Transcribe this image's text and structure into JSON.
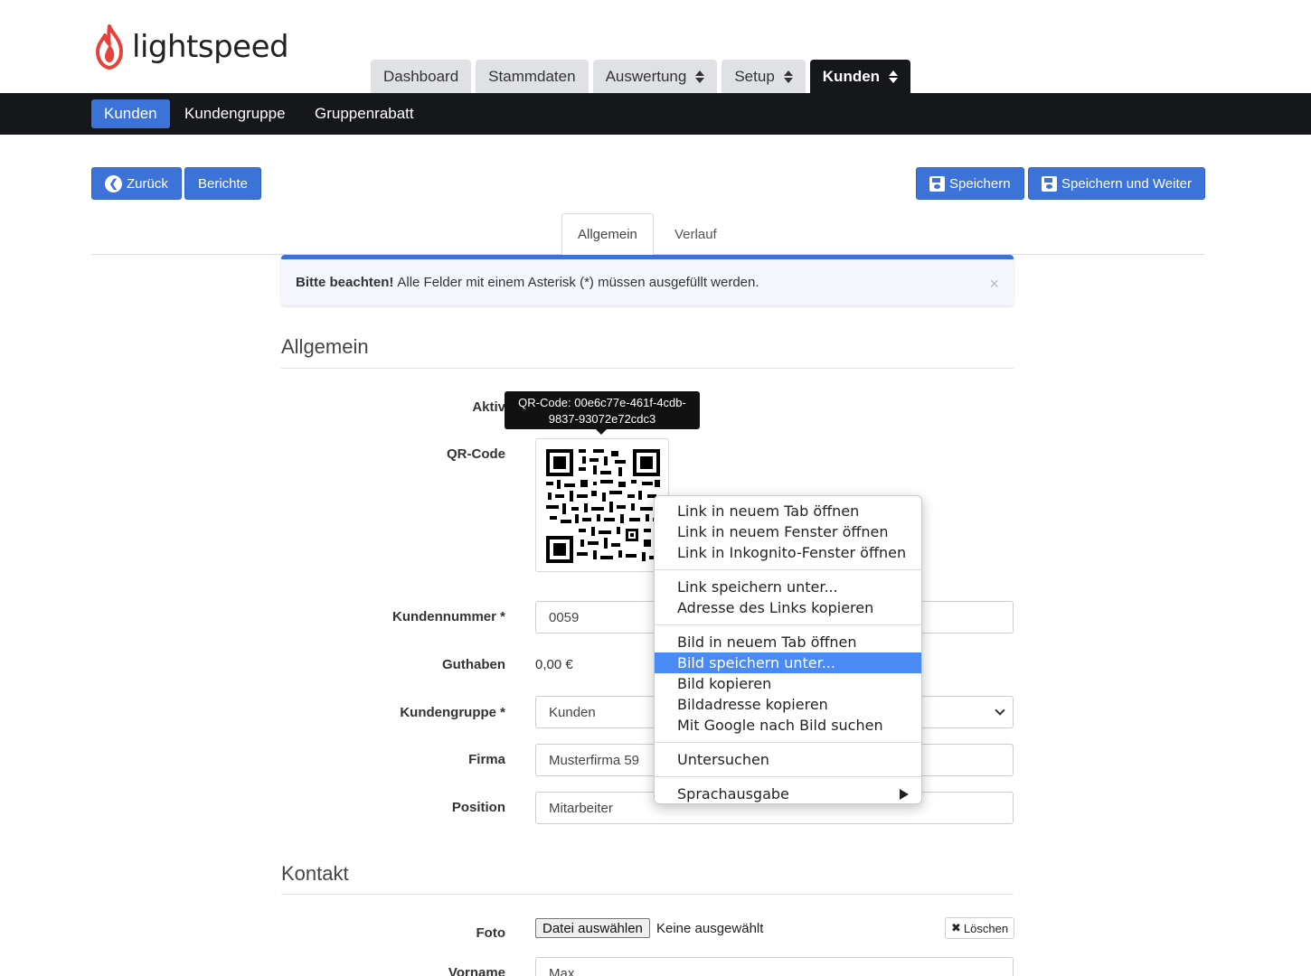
{
  "brand": {
    "name": "lightspeed",
    "logo_color": "#e8413c"
  },
  "main_tabs": [
    {
      "label": "Dashboard",
      "has_arrows": false,
      "active": false
    },
    {
      "label": "Stammdaten",
      "has_arrows": false,
      "active": false
    },
    {
      "label": "Auswertung",
      "has_arrows": true,
      "active": false
    },
    {
      "label": "Setup",
      "has_arrows": true,
      "active": false
    },
    {
      "label": "Kunden",
      "has_arrows": true,
      "active": true
    }
  ],
  "subnav": [
    {
      "label": "Kunden",
      "active": true
    },
    {
      "label": "Kundengruppe",
      "active": false
    },
    {
      "label": "Gruppenrabatt",
      "active": false
    }
  ],
  "actions": {
    "back_label": "Zurück",
    "reports_label": "Berichte",
    "save_label": "Speichern",
    "save_continue_label": "Speichern und Weiter"
  },
  "sub_tabs": [
    {
      "label": "Allgemein",
      "active": true
    },
    {
      "label": "Verlauf",
      "active": false
    }
  ],
  "alert": {
    "strong": "Bitte beachten!",
    "text": "Alle Felder mit einem Asterisk (*) müssen ausgefüllt werden.",
    "close": "×"
  },
  "section_general": {
    "title": "Allgemein",
    "active_label": "Aktiv",
    "qr_label": "QR-Code",
    "customer_number_label": "Kundennummer *",
    "customer_number_value": "0059",
    "credit_label": "Guthaben",
    "credit_value": "0,00 €",
    "group_label": "Kundengruppe *",
    "group_value": "Kunden",
    "company_label": "Firma",
    "company_value": "Musterfirma 59",
    "position_label": "Position",
    "position_value": "Mitarbeiter"
  },
  "tooltip": {
    "line1": "QR-Code: 00e6c77e-461f-4cdb-",
    "line2": "9837-93072e72cdc3"
  },
  "context_menu": {
    "groups": [
      [
        "Link in neuem Tab öffnen",
        "Link in neuem Fenster öffnen",
        "Link in Inkognito-Fenster öffnen"
      ],
      [
        "Link speichern unter...",
        "Adresse des Links kopieren"
      ],
      [
        "Bild in neuem Tab öffnen",
        "Bild speichern unter...",
        "Bild kopieren",
        "Bildadresse kopieren",
        "Mit Google nach Bild suchen"
      ],
      [
        "Untersuchen"
      ],
      [
        "Sprachausgabe"
      ]
    ],
    "highlighted": "Bild speichern unter...",
    "highlight_color": "#4a8af4",
    "submenu_item": "Sprachausgabe"
  },
  "section_contact": {
    "title": "Kontakt",
    "photo_label": "Foto",
    "file_button": "Datei auswählen",
    "file_status": "Keine ausgewählt",
    "delete_label": "Löschen",
    "firstname_label": "Vorname",
    "firstname_value": "Max"
  },
  "colors": {
    "primary": "#3c73d8",
    "navbar": "#16171b"
  }
}
